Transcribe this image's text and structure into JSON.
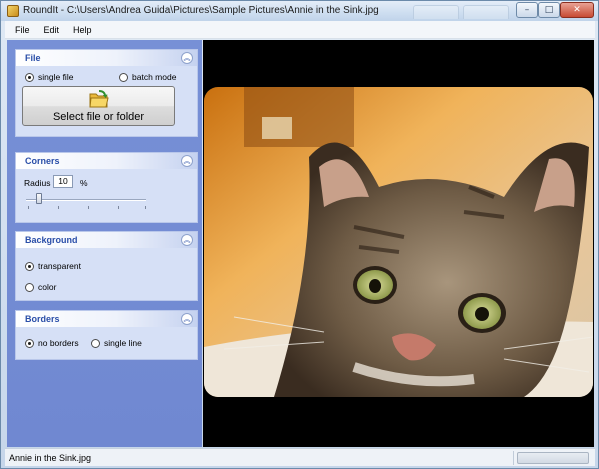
{
  "window": {
    "title": "RoundIt - C:\\Users\\Andrea Guida\\Pictures\\Sample Pictures\\Annie in the Sink.jpg",
    "minimize_glyph": "–",
    "maximize_glyph": "□",
    "close_glyph": "✕"
  },
  "menu": [
    "File",
    "Edit",
    "Help"
  ],
  "panels": {
    "file": {
      "title": "File",
      "collapse_glyph": "︽",
      "options": [
        {
          "label": "single file",
          "checked": true
        },
        {
          "label": "batch mode",
          "checked": false
        }
      ],
      "select_button_label": "Select file or folder"
    },
    "corners": {
      "title": "Corners",
      "collapse_glyph": "︽",
      "radius_label": "Radius",
      "radius_value": "10",
      "radius_unit": "%"
    },
    "background": {
      "title": "Background",
      "collapse_glyph": "︽",
      "options": [
        {
          "label": "transparent",
          "checked": true
        },
        {
          "label": "color",
          "checked": false
        }
      ]
    },
    "borders": {
      "title": "Borders",
      "collapse_glyph": "︽",
      "options": [
        {
          "label": "no borders",
          "checked": true
        },
        {
          "label": "single line",
          "checked": false
        }
      ]
    }
  },
  "status": {
    "filename": "Annie in the Sink.jpg"
  },
  "colors": {
    "panel_bg": "#7088d1",
    "group_bg": "#d6e0f6",
    "group_title": "#2a4ea8",
    "image_bg": "#000000"
  }
}
